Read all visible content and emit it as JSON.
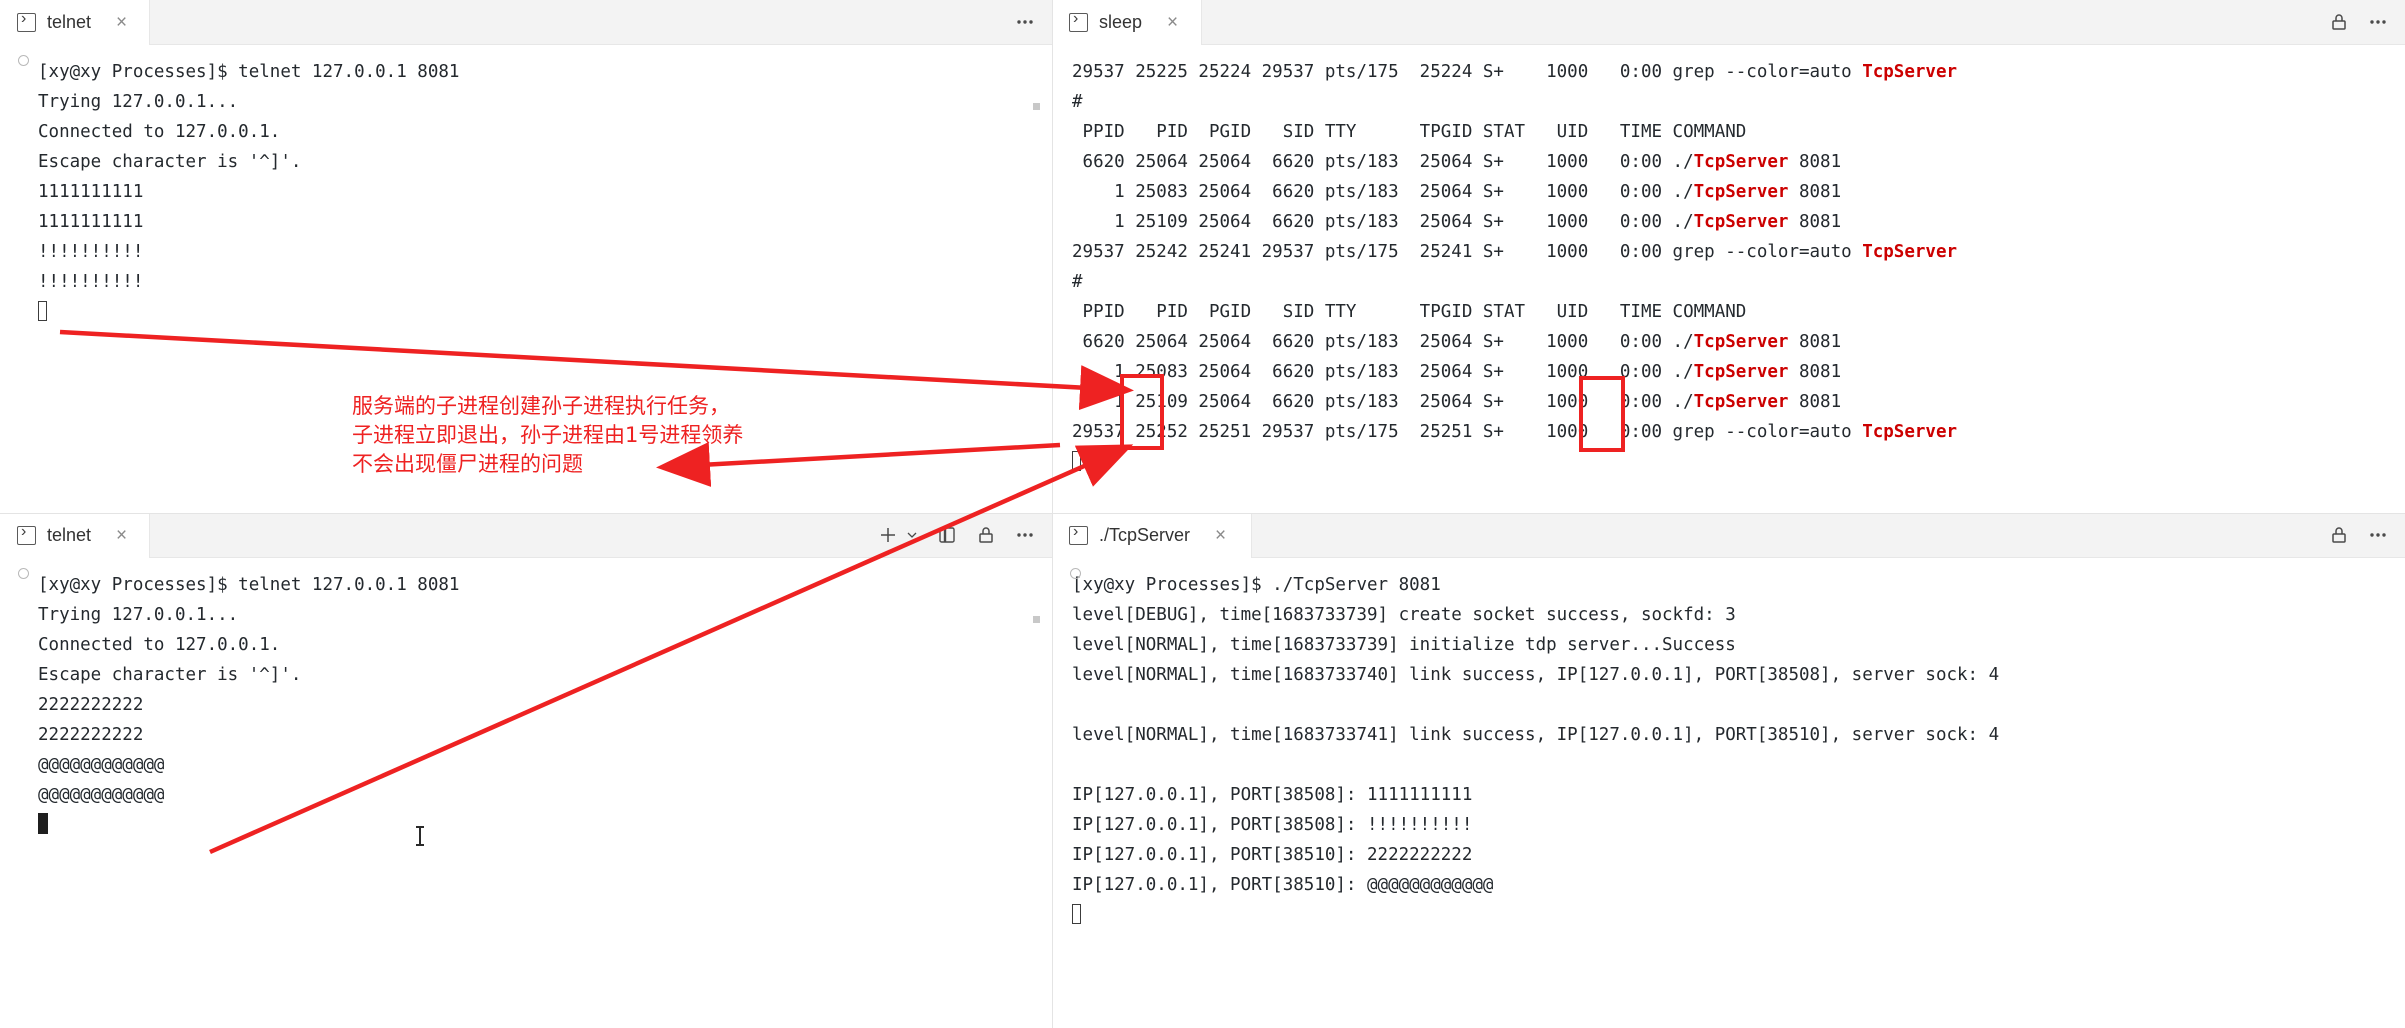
{
  "panes": {
    "top_left": {
      "tab": {
        "label": "telnet",
        "icon": "terminal-icon",
        "close": "×"
      },
      "lines": [
        "[xy@xy Processes]$ telnet 127.0.0.1 8081",
        "Trying 127.0.0.1...",
        "Connected to 127.0.0.1.",
        "Escape character is '^]'.",
        "1111111111",
        "1111111111",
        "!!!!!!!!!!",
        "!!!!!!!!!!"
      ]
    },
    "top_right": {
      "tab": {
        "label": "sleep",
        "icon": "terminal-icon",
        "close": "×"
      },
      "lines": [
        {
          "text": "29537 25225 25224 29537 pts/175  25224 S+    1000   0:00 grep --color=auto ",
          "red_tail": "TcpServer"
        },
        {
          "text": "#"
        },
        {
          "text": " PPID   PID  PGID   SID TTY      TPGID STAT   UID   TIME COMMAND"
        },
        {
          "text": " 6620 25064 25064  6620 pts/183  25064 S+    1000   0:00 ./",
          "red_tail": "TcpServer",
          "tail2": " 8081"
        },
        {
          "text": "    1 25083 25064  6620 pts/183  25064 S+    1000   0:00 ./",
          "red_tail": "TcpServer",
          "tail2": " 8081"
        },
        {
          "text": "    1 25109 25064  6620 pts/183  25064 S+    1000   0:00 ./",
          "red_tail": "TcpServer",
          "tail2": " 8081"
        },
        {
          "text": "29537 25242 25241 29537 pts/175  25241 S+    1000   0:00 grep --color=auto ",
          "red_tail": "TcpServer"
        },
        {
          "text": "#"
        },
        {
          "text": " PPID   PID  PGID   SID TTY      TPGID STAT   UID   TIME COMMAND"
        },
        {
          "text": " 6620 25064 25064  6620 pts/183  25064 S+    1000   0:00 ./",
          "red_tail": "TcpServer",
          "tail2": " 8081"
        },
        {
          "text": "    1 25083 25064  6620 pts/183  25064 S+    1000   0:00 ./",
          "red_tail": "TcpServer",
          "tail2": " 8081"
        },
        {
          "text": "    1 25109 25064  6620 pts/183  25064 S+    1000   0:00 ./",
          "red_tail": "TcpServer",
          "tail2": " 8081"
        },
        {
          "text": "29537 25252 25251 29537 pts/175  25251 S+    1000   0:00 grep --color=auto ",
          "red_tail": "TcpServer"
        }
      ]
    },
    "bottom_left": {
      "tab": {
        "label": "telnet",
        "icon": "terminal-icon",
        "close": "×"
      },
      "actions": {
        "new_terminal": "new-terminal-icon",
        "new_terminal_dropdown": "chevron-down-icon",
        "split_terminal": "split-terminal-icon",
        "kill_terminal": "kill-terminal-icon",
        "more": "more-actions-icon"
      },
      "lines": [
        "[xy@xy Processes]$ telnet 127.0.0.1 8081",
        "Trying 127.0.0.1...",
        "Connected to 127.0.0.1.",
        "Escape character is '^]'.",
        "2222222222",
        "2222222222",
        "@@@@@@@@@@@@",
        "@@@@@@@@@@@@"
      ]
    },
    "bottom_right": {
      "tab": {
        "label": "./TcpServer",
        "icon": "terminal-icon",
        "close": "×"
      },
      "lines": [
        "[xy@xy Processes]$ ./TcpServer 8081",
        "level[DEBUG], time[1683733739] create socket success, sockfd: 3",
        "level[NORMAL], time[1683733739] initialize tdp server...Success",
        "level[NORMAL], time[1683733740] link success, IP[127.0.0.1], PORT[38508], server sock: 4",
        "",
        "level[NORMAL], time[1683733741] link success, IP[127.0.0.1], PORT[38510], server sock: 4",
        "",
        "IP[127.0.0.1], PORT[38508]: 1111111111",
        "IP[127.0.0.1], PORT[38508]: !!!!!!!!!!",
        "IP[127.0.0.1], PORT[38510]: 2222222222",
        "IP[127.0.0.1], PORT[38510]: @@@@@@@@@@@@"
      ]
    }
  },
  "titlebar_right": {
    "lock_icon": "kill-terminal-icon",
    "more_icon": "more-actions-icon"
  },
  "annotation": {
    "text": "服务端的子进程创建孙子进程执行任务，\n子进程立即退出，孙子进程由1号进程领养\n不会出现僵尸进程的问题",
    "color": "#ee2222"
  },
  "colors": {
    "accent_red": "#cc0000",
    "annotation_red": "#ee2222",
    "tabbar_bg": "#f3f3f3",
    "terminal_fg": "#24292e"
  }
}
